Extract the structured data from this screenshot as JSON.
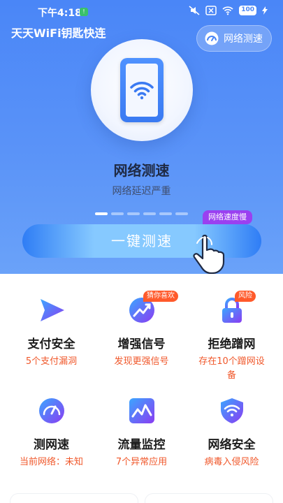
{
  "status_bar": {
    "time": "下午4:18",
    "notification_badge": "!",
    "icons": [
      "mute-icon",
      "close-box-icon",
      "wifi-icon",
      "battery-icon",
      "charging-icon"
    ],
    "battery": "100"
  },
  "header": {
    "app_title": "天天WiFi钥匙快连",
    "speed_test_button": "网络测速"
  },
  "hero": {
    "title": "网络测速",
    "subtitle": "网络延迟严重",
    "carousel_pages": 6,
    "carousel_active_index": 0,
    "badge": "网络速度慢",
    "action_button": "一键测速"
  },
  "features": [
    {
      "label": "支付安全",
      "desc": "5个支付漏洞",
      "tag": "",
      "icon": "send-arrow-icon"
    },
    {
      "label": "增强信号",
      "desc": "发现更强信号",
      "tag": "猜你喜欢",
      "icon": "signal-boost-icon"
    },
    {
      "label": "拒绝蹭网",
      "desc": "存在10个蹭网设备",
      "tag": "风险",
      "icon": "lock-icon"
    },
    {
      "label": "测网速",
      "desc": "当前网络：未知",
      "tag": "",
      "icon": "speedometer-icon"
    },
    {
      "label": "流量监控",
      "desc": "7个异常应用",
      "tag": "",
      "icon": "traffic-chart-icon"
    },
    {
      "label": "网络安全",
      "desc": "病毒入侵风险",
      "tag": "",
      "icon": "wifi-shield-icon"
    }
  ],
  "colors": {
    "hero_blue": "#4a86f7",
    "accent_orange": "#f0582b",
    "badge_purple": "#9a40f0",
    "tag_red": "#ff5a2b"
  }
}
